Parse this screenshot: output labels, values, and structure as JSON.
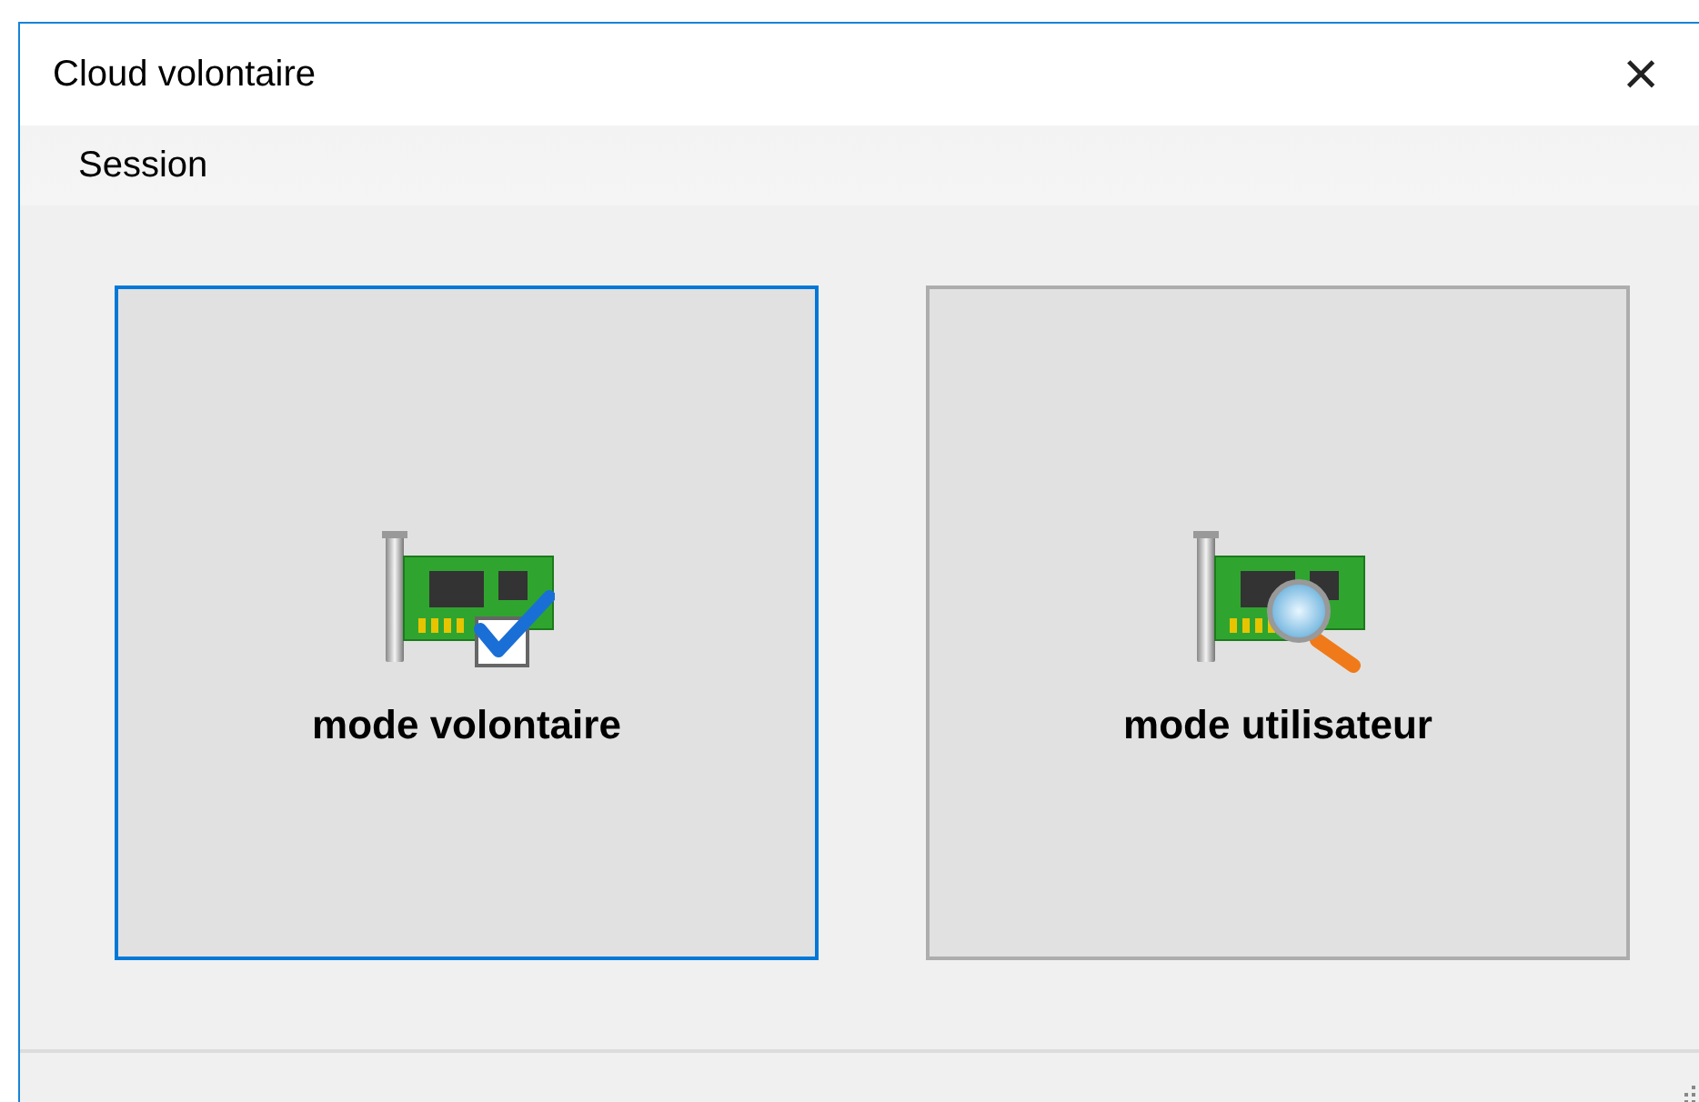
{
  "window": {
    "title": "Cloud volontaire",
    "close": "×"
  },
  "menu": [
    "Session"
  ],
  "modes": [
    {
      "label": "mode volontaire",
      "kind": "check",
      "selected": true
    },
    {
      "label": "mode utilisateur",
      "kind": "search",
      "selected": false
    }
  ]
}
